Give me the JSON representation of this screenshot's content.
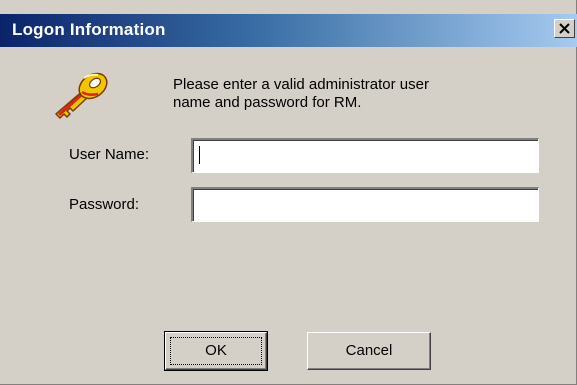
{
  "window": {
    "title": "Logon Information",
    "close_glyph": "✕"
  },
  "icons": {
    "key": "key-icon",
    "close": "close-icon"
  },
  "message": {
    "line1": "Please enter a valid administrator user",
    "line2": "name and password for RM."
  },
  "form": {
    "username_label": "User Name:",
    "username_value": "",
    "password_label": "Password:",
    "password_value": ""
  },
  "buttons": {
    "ok_label": "OK",
    "cancel_label": "Cancel"
  },
  "colors": {
    "titlebar_start": "#0a246a",
    "titlebar_end": "#a6caf0",
    "dialog_face": "#d4d0c8",
    "key_gold": "#f2c500",
    "key_red": "#e02010"
  }
}
